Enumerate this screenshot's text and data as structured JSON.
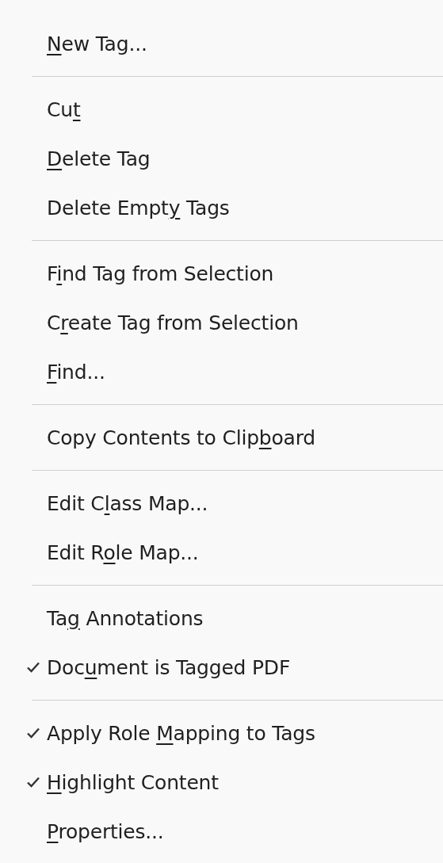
{
  "menu": {
    "items": [
      {
        "kind": "command",
        "key": "N",
        "after": "ew Tag...",
        "checked": false
      },
      {
        "kind": "separator"
      },
      {
        "kind": "command",
        "before": "Cu",
        "key": "t",
        "checked": false
      },
      {
        "kind": "command",
        "key": "D",
        "after": "elete Tag",
        "checked": false
      },
      {
        "kind": "command",
        "before": "Delete Empt",
        "key": "y",
        "after": " Tags",
        "checked": false
      },
      {
        "kind": "separator"
      },
      {
        "kind": "command",
        "before": "F",
        "key": "i",
        "after": "nd Tag from Selection",
        "checked": false
      },
      {
        "kind": "command",
        "before": "C",
        "key": "r",
        "after": "eate Tag from Selection",
        "checked": false
      },
      {
        "kind": "command",
        "key": "F",
        "after": "ind...",
        "checked": false
      },
      {
        "kind": "separator"
      },
      {
        "kind": "command",
        "before": "Copy Contents to Clip",
        "key": "b",
        "after": "oard",
        "checked": false
      },
      {
        "kind": "separator"
      },
      {
        "kind": "command",
        "before": "Edit C",
        "key": "l",
        "after": "ass Map...",
        "checked": false
      },
      {
        "kind": "command",
        "before": "Edit R",
        "key": "o",
        "after": "le Map...",
        "checked": false
      },
      {
        "kind": "separator"
      },
      {
        "kind": "command",
        "before": "Ta",
        "key": "g",
        "after": " Annotations",
        "checked": false
      },
      {
        "kind": "command",
        "before": "Doc",
        "key": "u",
        "after": "ment is Tagged PDF",
        "checked": true
      },
      {
        "kind": "separator"
      },
      {
        "kind": "command",
        "before": "Apply Role ",
        "key": "M",
        "after": "apping to Tags",
        "checked": true
      },
      {
        "kind": "command",
        "key": "H",
        "after": "ighlight Content",
        "checked": true
      },
      {
        "kind": "command",
        "key": "P",
        "after": "roperties...",
        "checked": false
      }
    ]
  }
}
